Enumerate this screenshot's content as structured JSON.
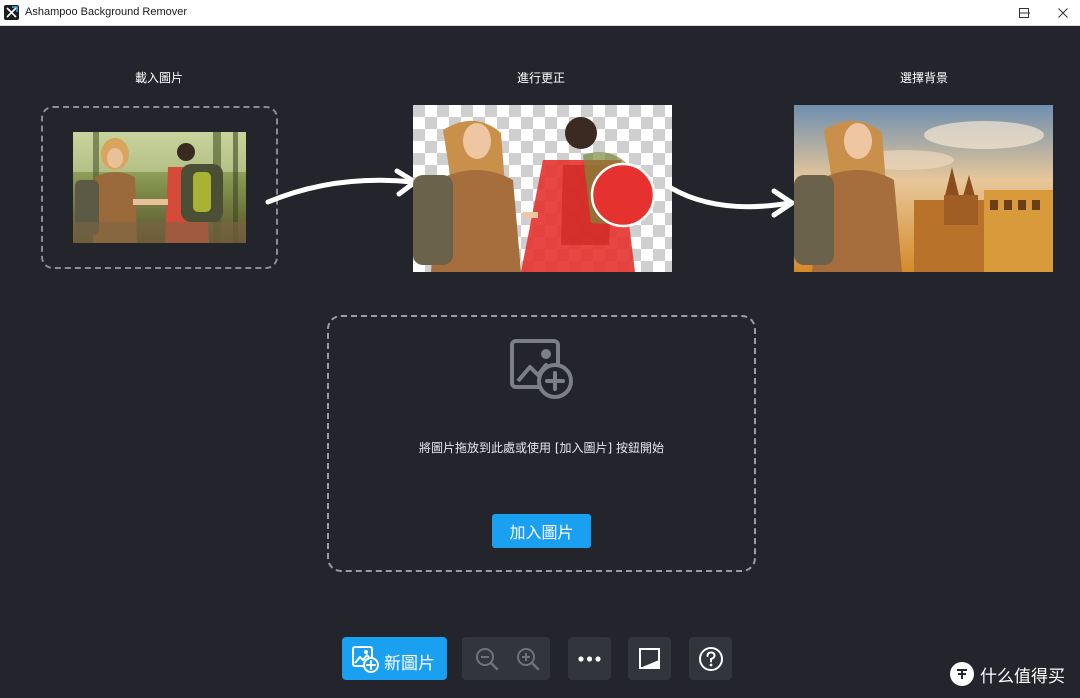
{
  "window": {
    "title": "Ashampoo Background Remover",
    "controls": [
      "minimize",
      "maximize",
      "close"
    ]
  },
  "steps": [
    {
      "label": "載入圖片"
    },
    {
      "label": "進行更正"
    },
    {
      "label": "選擇背景"
    }
  ],
  "drop_zone": {
    "icon": "add-image-icon",
    "instruction": "將圖片拖放到此處或使用 [加入圖片] 按鈕開始",
    "button_label": "加入圖片"
  },
  "toolbar": {
    "new_image_label": "新圖片",
    "buttons": [
      "zoom-out-icon",
      "zoom-in-icon",
      "more-icon",
      "compare-icon",
      "help-icon"
    ]
  },
  "watermark": {
    "text": "什么值得买"
  },
  "colors": {
    "background": "#24252c",
    "accent": "#1aa0f0",
    "toolbar_button": "#33353d",
    "dashed_border": "#8a8d96",
    "mask_red": "#e5322e"
  }
}
